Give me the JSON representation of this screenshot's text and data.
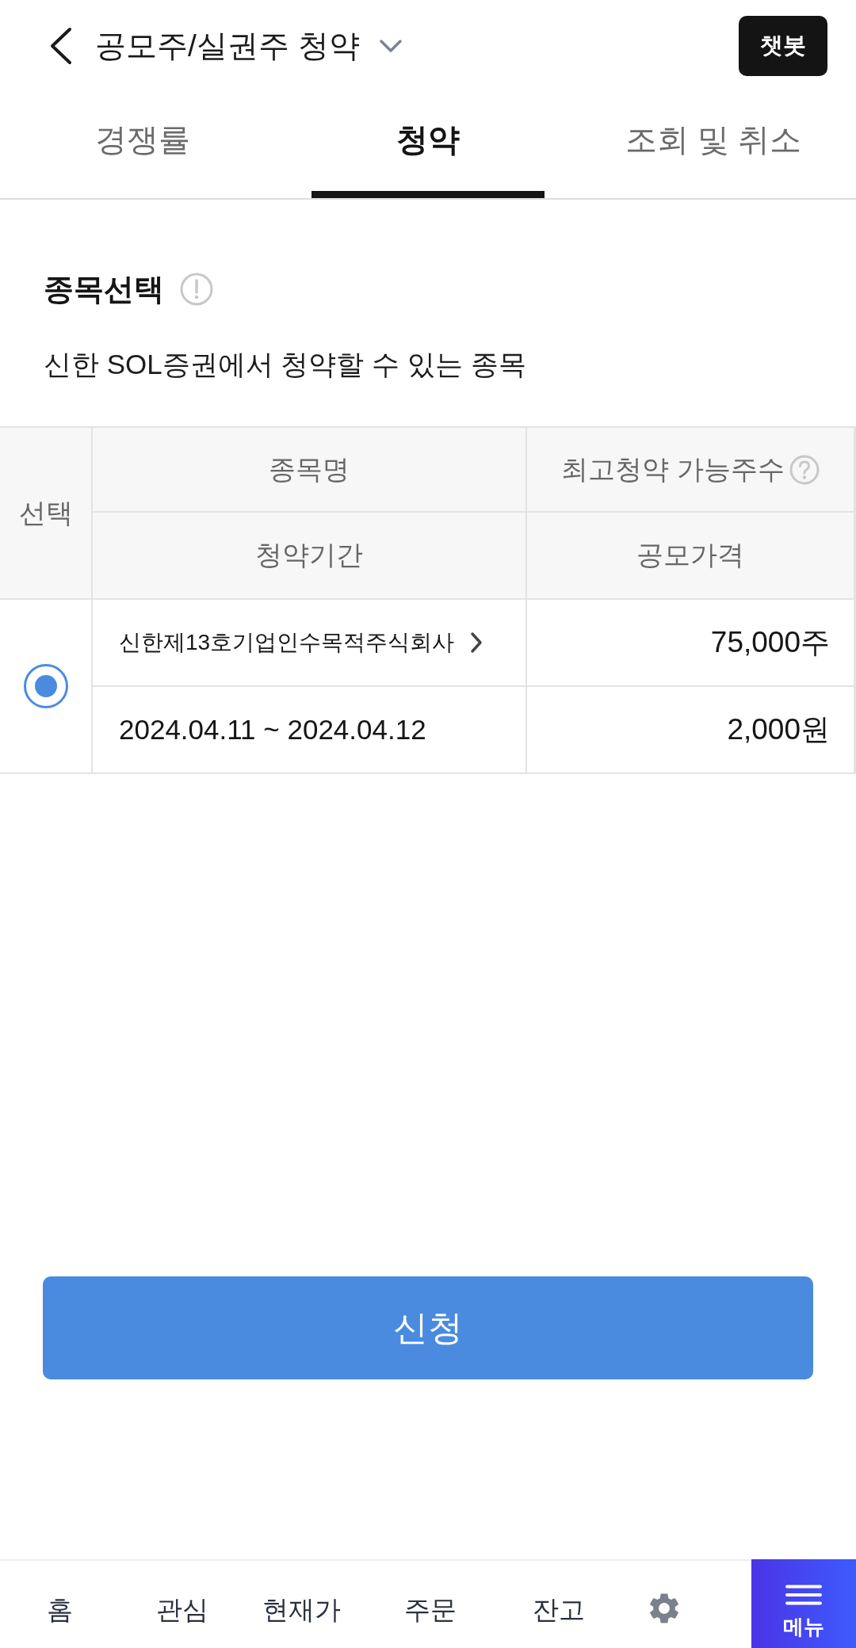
{
  "header": {
    "title": "공모주/실권주 청약",
    "chatbot_button": "챗봇"
  },
  "tabs": [
    {
      "label": "경쟁률",
      "selected": false
    },
    {
      "label": "청약",
      "selected": true
    },
    {
      "label": "조회 및 취소",
      "selected": false
    }
  ],
  "section": {
    "title": "종목선택",
    "description": "신한 SOL증권에서 청약할 수 있는 종목"
  },
  "table": {
    "header": {
      "select": "선택",
      "name": "종목명",
      "max_shares": "최고청약 가능주수",
      "period": "청약기간",
      "price": "공모가격"
    },
    "rows": [
      {
        "selected": true,
        "name": "신한제13호기업인수목적주식회사",
        "max_shares": "75,000주",
        "period": "2024.04.11 ~ 2024.04.12",
        "price": "2,000원"
      }
    ]
  },
  "submit_button": "신청",
  "bottom_nav": {
    "items": [
      "홈",
      "관심",
      "현재가",
      "주문",
      "잔고"
    ],
    "menu_button": "메뉴"
  }
}
